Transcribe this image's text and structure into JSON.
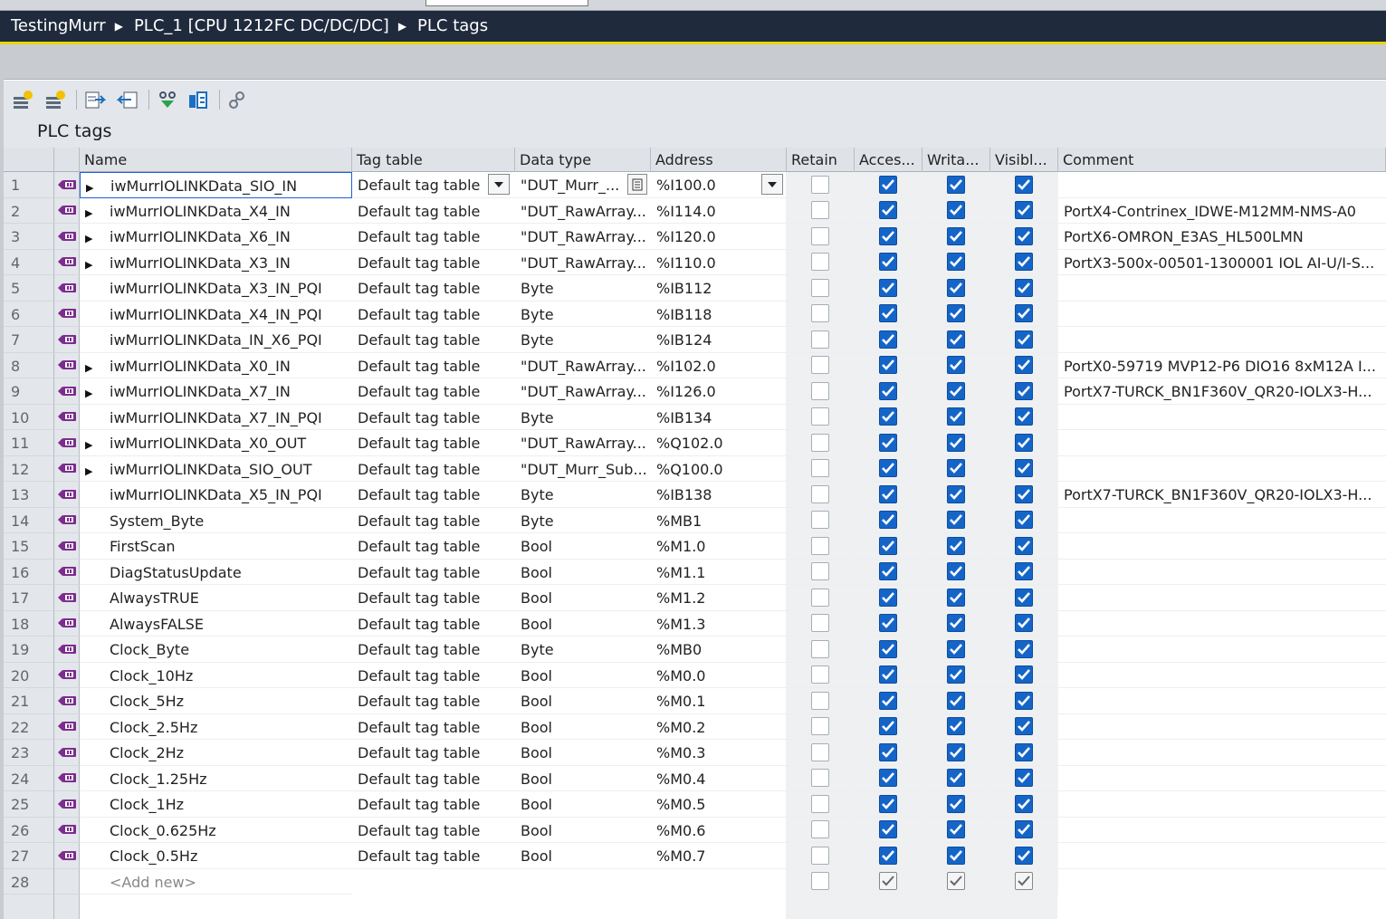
{
  "breadcrumb": [
    "TestingMurr",
    "PLC_1 [CPU 1212FC DC/DC/DC]",
    "PLC tags"
  ],
  "table_title": "PLC tags",
  "toolbar": [
    {
      "name": "add-tag-icon"
    },
    {
      "name": "insert-tag-icon"
    },
    {
      "name": "export-icon"
    },
    {
      "name": "import-icon"
    },
    {
      "name": "monitor-icon"
    },
    {
      "name": "tag-properties-icon"
    },
    {
      "name": "cross-reference-icon"
    }
  ],
  "columns": [
    "Name",
    "Tag table",
    "Data type",
    "Address",
    "Retain",
    "Acces...",
    "Writa...",
    "Visibl...",
    "Comment"
  ],
  "rows": [
    {
      "num": "1",
      "expand": true,
      "name": "iwMurrIOLINKData_SIO_IN",
      "table": "Default tag table",
      "type": "\"DUT_Murr_...",
      "addr": "%I100.0",
      "comment": ""
    },
    {
      "num": "2",
      "expand": true,
      "name": "iwMurrIOLINKData_X4_IN",
      "table": "Default tag table",
      "type": "\"DUT_RawArray...",
      "addr": "%I114.0",
      "comment": "PortX4-Contrinex_IDWE-M12MM-NMS-A0"
    },
    {
      "num": "3",
      "expand": true,
      "name": "iwMurrIOLINKData_X6_IN",
      "table": "Default tag table",
      "type": "\"DUT_RawArray...",
      "addr": "%I120.0",
      "comment": "PortX6-OMRON_E3AS_HL500LMN"
    },
    {
      "num": "4",
      "expand": true,
      "name": "iwMurrIOLINKData_X3_IN",
      "table": "Default tag table",
      "type": "\"DUT_RawArray...",
      "addr": "%I110.0",
      "comment": "PortX3-500x-00501-1300001 IOL AI-U/I-S..."
    },
    {
      "num": "5",
      "expand": false,
      "name": "iwMurrIOLINKData_X3_IN_PQI",
      "table": "Default tag table",
      "type": "Byte",
      "addr": "%IB112",
      "comment": ""
    },
    {
      "num": "6",
      "expand": false,
      "name": "iwMurrIOLINKData_X4_IN_PQI",
      "table": "Default tag table",
      "type": "Byte",
      "addr": "%IB118",
      "comment": ""
    },
    {
      "num": "7",
      "expand": false,
      "name": "iwMurrIOLINKData_IN_X6_PQI",
      "table": "Default tag table",
      "type": "Byte",
      "addr": "%IB124",
      "comment": ""
    },
    {
      "num": "8",
      "expand": true,
      "name": "iwMurrIOLINKData_X0_IN",
      "table": "Default tag table",
      "type": "\"DUT_RawArray...",
      "addr": "%I102.0",
      "comment": "PortX0-59719 MVP12-P6 DIO16 8xM12A I..."
    },
    {
      "num": "9",
      "expand": true,
      "name": "iwMurrIOLINKData_X7_IN",
      "table": "Default tag table",
      "type": "\"DUT_RawArray...",
      "addr": "%I126.0",
      "comment": "PortX7-TURCK_BN1F360V_QR20-IOLX3-H..."
    },
    {
      "num": "10",
      "expand": false,
      "name": "iwMurrIOLINKData_X7_IN_PQI",
      "table": "Default tag table",
      "type": "Byte",
      "addr": "%IB134",
      "comment": ""
    },
    {
      "num": "11",
      "expand": true,
      "name": "iwMurrIOLINKData_X0_OUT",
      "table": "Default tag table",
      "type": "\"DUT_RawArray...",
      "addr": "%Q102.0",
      "comment": ""
    },
    {
      "num": "12",
      "expand": true,
      "name": "iwMurrIOLINKData_SIO_OUT",
      "table": "Default tag table",
      "type": "\"DUT_Murr_Sub...",
      "addr": "%Q100.0",
      "comment": ""
    },
    {
      "num": "13",
      "expand": false,
      "name": "iwMurrIOLINKData_X5_IN_PQI",
      "table": "Default tag table",
      "type": "Byte",
      "addr": "%IB138",
      "comment": "PortX7-TURCK_BN1F360V_QR20-IOLX3-H..."
    },
    {
      "num": "14",
      "expand": false,
      "name": "System_Byte",
      "table": "Default tag table",
      "type": "Byte",
      "addr": "%MB1",
      "comment": ""
    },
    {
      "num": "15",
      "expand": false,
      "name": "FirstScan",
      "table": "Default tag table",
      "type": "Bool",
      "addr": "%M1.0",
      "comment": ""
    },
    {
      "num": "16",
      "expand": false,
      "name": "DiagStatusUpdate",
      "table": "Default tag table",
      "type": "Bool",
      "addr": "%M1.1",
      "comment": ""
    },
    {
      "num": "17",
      "expand": false,
      "name": "AlwaysTRUE",
      "table": "Default tag table",
      "type": "Bool",
      "addr": "%M1.2",
      "comment": ""
    },
    {
      "num": "18",
      "expand": false,
      "name": "AlwaysFALSE",
      "table": "Default tag table",
      "type": "Bool",
      "addr": "%M1.3",
      "comment": ""
    },
    {
      "num": "19",
      "expand": false,
      "name": "Clock_Byte",
      "table": "Default tag table",
      "type": "Byte",
      "addr": "%MB0",
      "comment": ""
    },
    {
      "num": "20",
      "expand": false,
      "name": "Clock_10Hz",
      "table": "Default tag table",
      "type": "Bool",
      "addr": "%M0.0",
      "comment": ""
    },
    {
      "num": "21",
      "expand": false,
      "name": "Clock_5Hz",
      "table": "Default tag table",
      "type": "Bool",
      "addr": "%M0.1",
      "comment": ""
    },
    {
      "num": "22",
      "expand": false,
      "name": "Clock_2.5Hz",
      "table": "Default tag table",
      "type": "Bool",
      "addr": "%M0.2",
      "comment": ""
    },
    {
      "num": "23",
      "expand": false,
      "name": "Clock_2Hz",
      "table": "Default tag table",
      "type": "Bool",
      "addr": "%M0.3",
      "comment": ""
    },
    {
      "num": "24",
      "expand": false,
      "name": "Clock_1.25Hz",
      "table": "Default tag table",
      "type": "Bool",
      "addr": "%M0.4",
      "comment": ""
    },
    {
      "num": "25",
      "expand": false,
      "name": "Clock_1Hz",
      "table": "Default tag table",
      "type": "Bool",
      "addr": "%M0.5",
      "comment": ""
    },
    {
      "num": "26",
      "expand": false,
      "name": "Clock_0.625Hz",
      "table": "Default tag table",
      "type": "Bool",
      "addr": "%M0.6",
      "comment": ""
    },
    {
      "num": "27",
      "expand": false,
      "name": "Clock_0.5Hz",
      "table": "Default tag table",
      "type": "Bool",
      "addr": "%M0.7",
      "comment": ""
    }
  ],
  "add_new": {
    "num": "28",
    "label": "<Add new>"
  },
  "colors": {
    "titlebar": "#1f2b3d",
    "accent": "#e8d700",
    "checkbox": "#1565c8"
  }
}
